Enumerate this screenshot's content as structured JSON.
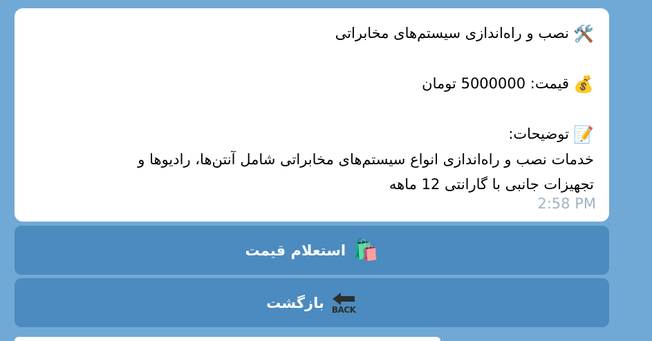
{
  "message": {
    "title_emoji": "🛠️",
    "title": "نصب و راه‌اندازی سیستم‌های مخابراتی",
    "price_emoji": "💰",
    "price_text": "قیمت: 5000000 تومان",
    "desc_emoji": "📝",
    "desc_label": "توضیحات:",
    "desc_line1": "خدمات نصب و راه‌اندازی انواع سیستم‌های مخابراتی شامل آنتن‌ها، رادیوها و",
    "desc_line2": "تجهیزات جانبی با گارانتی 12 ماهه",
    "time": "2:58 PM"
  },
  "keyboard": {
    "price_inquiry": {
      "emoji": "🛍️",
      "label": "استعلام قیمت"
    },
    "back": {
      "icon_text": "BACK",
      "label": "بازگشت"
    }
  }
}
